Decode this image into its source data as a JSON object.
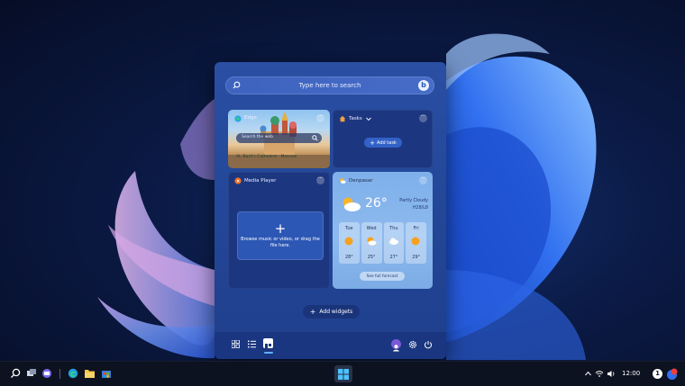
{
  "search": {
    "placeholder": "Type here to search"
  },
  "widgets": {
    "edge": {
      "title": "Edge",
      "search_placeholder": "Search the web",
      "links": "St. Basil's Cathedral · Moscow"
    },
    "tasks": {
      "title": "Tasks",
      "add_label": "Add task"
    },
    "media": {
      "title": "Media Player",
      "drop_text": "Browse music or video, or drag the file here."
    },
    "weather": {
      "title": "Denpasar",
      "temp": "26°",
      "condition": "Partly Cloudy",
      "range": "H28/L8",
      "days": [
        {
          "name": "Tue",
          "temp": "28°",
          "icon": "sun-icon"
        },
        {
          "name": "Wed",
          "temp": "25°",
          "icon": "partly-cloudy-icon"
        },
        {
          "name": "Thu",
          "temp": "27°",
          "icon": "cloud-icon"
        },
        {
          "name": "Fri",
          "temp": "29°",
          "icon": "sun-icon"
        }
      ],
      "forecast_label": "See full forecast"
    }
  },
  "add_widgets_label": "Add widgets",
  "taskbar": {
    "time": "12:00",
    "notification_count": "1"
  },
  "colors": {
    "accent": "#3262c8",
    "panel": "#24489a",
    "taskbar": "#0d1221"
  }
}
